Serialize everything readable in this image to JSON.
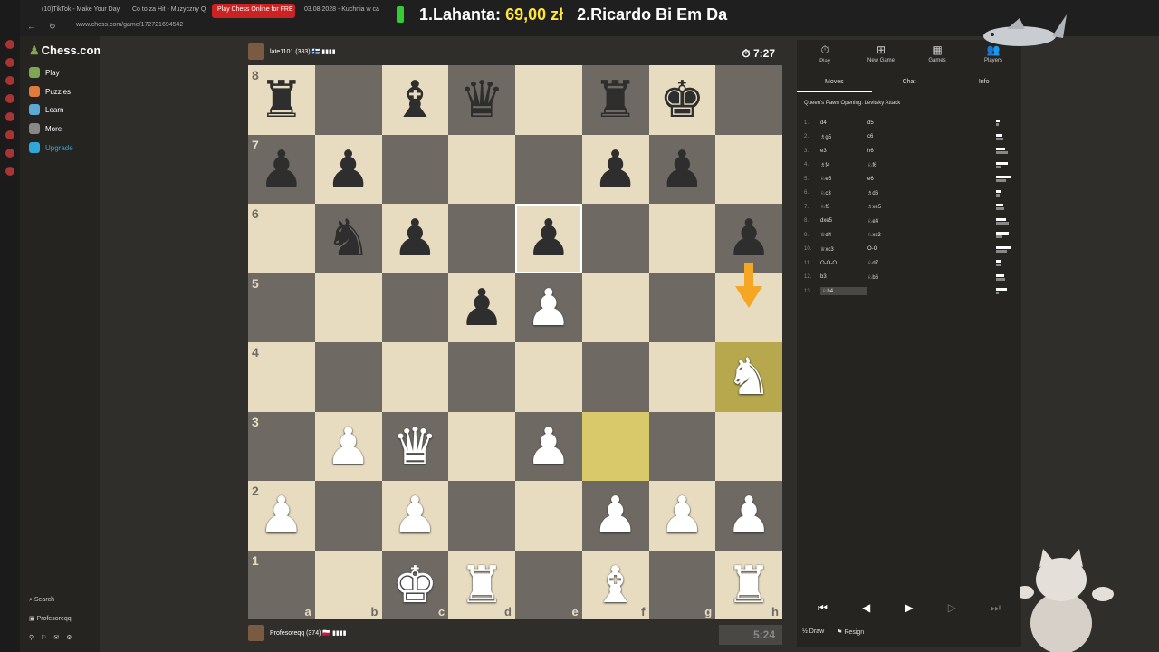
{
  "browser": {
    "tabs": [
      {
        "label": "(10)TikTok - Make Your Day",
        "active": false
      },
      {
        "label": "Co to za Hit - Muzyczny Q",
        "active": false
      },
      {
        "label": "Play Chess Online for FRE",
        "active": true
      },
      {
        "label": "03.08.2028 - Kuchnia w ca",
        "active": false
      }
    ],
    "url": "www.chess.com/game/172721694542"
  },
  "stream_banner": {
    "first": "1.Lahanta:",
    "first_amount": "69,00 zł",
    "second": "2.Ricardo Bi Em Da"
  },
  "sidebar": {
    "logo": "Chess.com",
    "items": [
      {
        "label": "Play",
        "color": "#7fa650"
      },
      {
        "label": "Puzzles",
        "color": "#e07b39"
      },
      {
        "label": "Learn",
        "color": "#5da9d6"
      },
      {
        "label": "More",
        "color": "#888888"
      },
      {
        "label": "Upgrade",
        "color": "#2fa7d8"
      }
    ],
    "search": "Search",
    "user": "Profesoreqq"
  },
  "top_player": {
    "name": "late1101 (383) 🇫🇮 ▮▮▮▮",
    "clock": "7:27"
  },
  "bottom_player": {
    "name": "Profesoreqq (374) 🇵🇱 ▮▮▮▮",
    "clock": "5:24"
  },
  "board": {
    "ranks": [
      "8",
      "7",
      "6",
      "5",
      "4",
      "3",
      "2",
      "1"
    ],
    "files": [
      "a",
      "b",
      "c",
      "d",
      "e",
      "f",
      "g",
      "h"
    ],
    "rows": [
      [
        "bR",
        "",
        "bB",
        "bQ",
        "",
        "bR",
        "bK",
        ""
      ],
      [
        "bP",
        "bP",
        "",
        "",
        "",
        "bP",
        "bP",
        ""
      ],
      [
        "",
        "bN",
        "bP",
        "",
        "bP",
        "",
        "",
        "bP"
      ],
      [
        "",
        "",
        "",
        "bP",
        "wP",
        "",
        "",
        ""
      ],
      [
        "",
        "",
        "",
        "",
        "",
        "",
        "",
        "wN"
      ],
      [
        "",
        "wP",
        "wQ",
        "",
        "wP",
        "",
        "",
        ""
      ],
      [
        "wP",
        "",
        "wP",
        "",
        "",
        "wP",
        "wP",
        "wP"
      ],
      [
        "",
        "",
        "wK",
        "wR",
        "",
        "wB",
        "",
        "wR"
      ]
    ],
    "highlight": [
      "h4",
      "f3"
    ],
    "selected": "e6"
  },
  "panel": {
    "icons": [
      {
        "label": "Play",
        "glyph": "⏱"
      },
      {
        "label": "New Game",
        "glyph": "⊞"
      },
      {
        "label": "Games",
        "glyph": "▦"
      },
      {
        "label": "Players",
        "glyph": "👥"
      }
    ],
    "tabs": [
      "Moves",
      "Chat",
      "Info"
    ],
    "opening": "Queen's Pawn Opening: Levitsky Attack",
    "moves": [
      {
        "n": "1.",
        "w": "d4",
        "b": "d5"
      },
      {
        "n": "2.",
        "w": "♗g5",
        "b": "c6"
      },
      {
        "n": "3.",
        "w": "e3",
        "b": "h6"
      },
      {
        "n": "4.",
        "w": "♗f4",
        "b": "♘f6"
      },
      {
        "n": "5.",
        "w": "♘e5",
        "b": "e6"
      },
      {
        "n": "6.",
        "w": "♘c3",
        "b": "♗d6"
      },
      {
        "n": "7.",
        "w": "♘f3",
        "b": "♗xe5"
      },
      {
        "n": "8.",
        "w": "dxe5",
        "b": "♘e4"
      },
      {
        "n": "9.",
        "w": "♕d4",
        "b": "♘xc3"
      },
      {
        "n": "10.",
        "w": "♕xc3",
        "b": "O-O"
      },
      {
        "n": "11.",
        "w": "O-O-O",
        "b": "♘d7"
      },
      {
        "n": "12.",
        "w": "b3",
        "b": "♘b6"
      },
      {
        "n": "13.",
        "w": "♘h4",
        "b": ""
      }
    ],
    "draw": "Draw",
    "resign": "Resign"
  }
}
